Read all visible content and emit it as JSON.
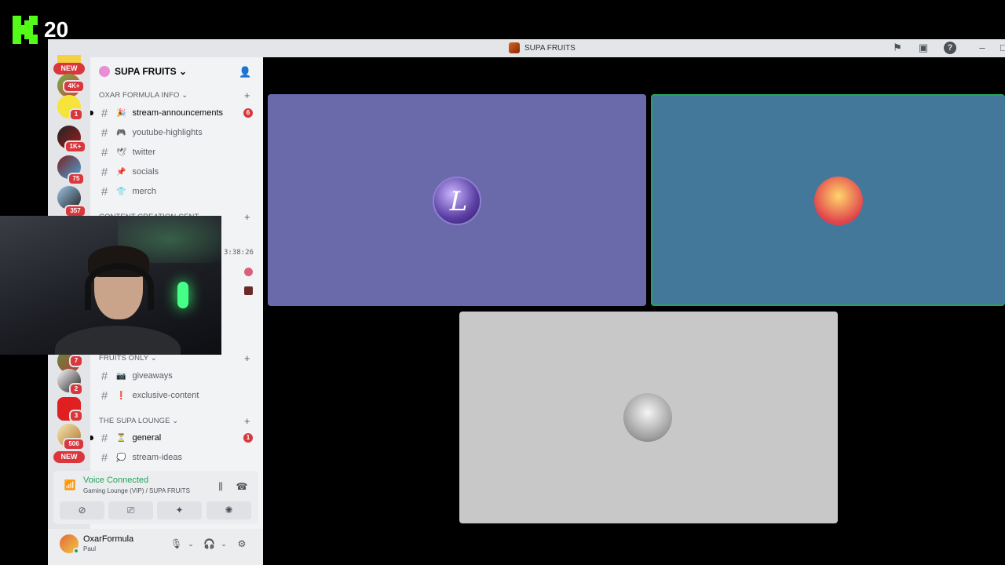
{
  "overlay": {
    "channel_number": "20"
  },
  "window": {
    "title": "SUPA FRUITS"
  },
  "rail": {
    "badges": [
      "4K+",
      "1",
      "1K+",
      "75",
      "357",
      "7",
      "2",
      "3",
      "506"
    ],
    "new_label": "NEW"
  },
  "server": {
    "name": "SUPA FRUITS ⌄"
  },
  "categories": [
    {
      "name": "OXAR FORMULA INFO ⌄"
    },
    {
      "name": "Content Creation Cent..."
    },
    {
      "name": "FRUITS ONLY ⌄"
    },
    {
      "name": "THE SUPA LOUNGE ⌄"
    }
  ],
  "channels": {
    "stream_announcements": {
      "label": "stream-announcements",
      "emoji": "🎉",
      "badge": "6"
    },
    "youtube_highlights": {
      "label": "youtube-highlights",
      "emoji": "🎮"
    },
    "twitter": {
      "label": "twitter",
      "emoji": "🕊"
    },
    "socials": {
      "label": "socials",
      "emoji": "📌"
    },
    "merch": {
      "label": "merch",
      "emoji": "👕"
    },
    "giveaways": {
      "label": "giveaways",
      "emoji": "📷"
    },
    "exclusive_content": {
      "label": "exclusive-content",
      "emoji": "❗"
    },
    "general": {
      "label": "general",
      "emoji": "⏳",
      "badge": "1"
    },
    "stream_ideas": {
      "label": "stream-ideas",
      "emoji": "💭"
    }
  },
  "timestamp": "3:38:26",
  "voice": {
    "status": "Voice Connected",
    "location": "Gaming Lounge (VIP) / SUPA FRUITS"
  },
  "user": {
    "name": "OxarFormula",
    "sub": "Paul"
  },
  "colors": {
    "accent_green": "#23a55a",
    "badge_red": "#da373c",
    "tile_a": "#6a6aab",
    "tile_b": "#43789b",
    "tile_c": "#c8c8c8"
  }
}
